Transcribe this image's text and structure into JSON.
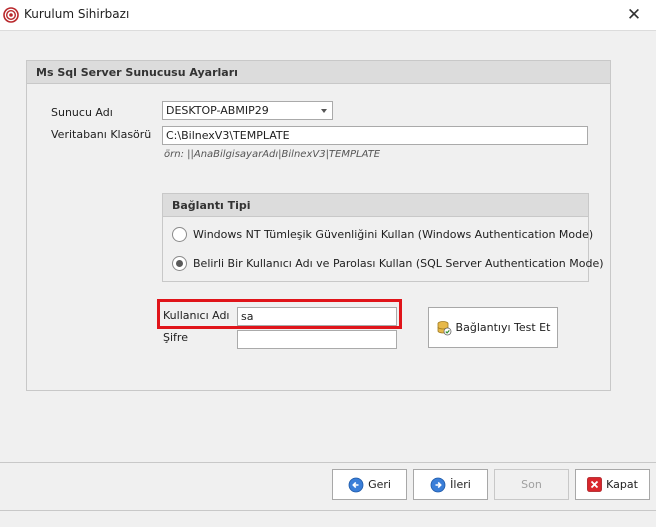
{
  "window": {
    "title": "Kurulum Sihirbazı",
    "close_glyph": "✕"
  },
  "group": {
    "title": "Ms Sql Server Sunucusu Ayarları",
    "server_label": "Sunucu Adı",
    "server_value": "DESKTOP-ABMIP29",
    "folder_label": "Veritabanı Klasörü",
    "folder_value": "C:\\BilnexV3\\TEMPLATE",
    "folder_hint": "örn: ||AnaBilgisayarAdı|BilnexV3|TEMPLATE"
  },
  "connection_type": {
    "title": "Bağlantı Tipi",
    "options": [
      {
        "label": "Windows NT Tümleşik Güvenliğini Kullan (Windows Authentication Mode)",
        "checked": false
      },
      {
        "label": "Belirli Bir Kullanıcı Adı ve Parolası Kullan (SQL Server Authentication Mode)",
        "checked": true
      }
    ]
  },
  "credentials": {
    "username_label": "Kullanıcı Adı",
    "username_value": "sa",
    "password_label": "Şifre",
    "password_value": ""
  },
  "test_button": {
    "label": "Bağlantıyı Test Et",
    "icon": "database-check-icon"
  },
  "footer": {
    "back_label": "Geri",
    "next_label": "İleri",
    "finish_label": "Son",
    "cancel_label": "Kapat"
  },
  "colors": {
    "highlight": "#e0141a",
    "nav_icon_blue": "#3a7ed8",
    "cancel_icon_red": "#d9262c"
  }
}
